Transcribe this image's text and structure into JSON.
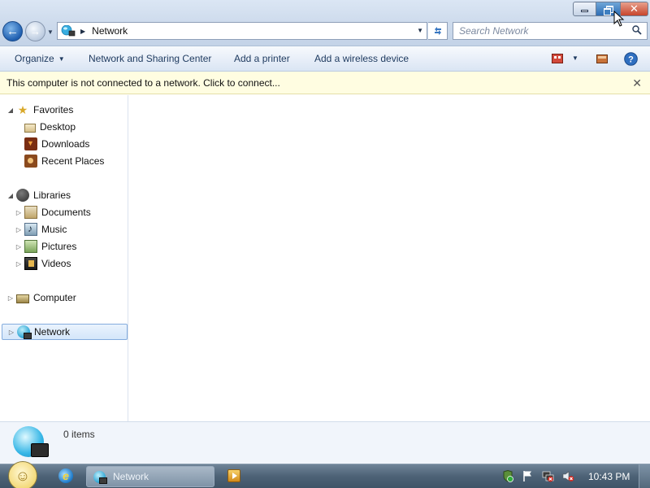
{
  "window": {
    "caption_buttons": {
      "minimize_icon": "minimize-icon",
      "restore_icon": "restore-icon",
      "close_icon": "close-icon"
    }
  },
  "navigation": {
    "back_icon": "back-arrow-icon",
    "forward_icon": "forward-arrow-icon"
  },
  "address_bar": {
    "location_icon": "network-icon",
    "path": "Network"
  },
  "search": {
    "placeholder": "Search Network"
  },
  "command_bar": {
    "organize": "Organize",
    "network_sharing_center": "Network and Sharing Center",
    "add_printer": "Add a printer",
    "add_wireless_device": "Add a wireless device"
  },
  "info_bar": {
    "message": "This computer is not connected to a network. Click to connect..."
  },
  "nav_pane": {
    "favorites": {
      "label": "Favorites",
      "items": [
        "Desktop",
        "Downloads",
        "Recent Places"
      ]
    },
    "libraries": {
      "label": "Libraries",
      "items": [
        "Documents",
        "Music",
        "Pictures",
        "Videos"
      ]
    },
    "computer": "Computer",
    "network": "Network"
  },
  "details_pane": {
    "item_count": "0 items"
  },
  "taskbar": {
    "active_task": "Network",
    "clock": "10:43 PM"
  },
  "colors": {
    "accent": "#2e6db4",
    "info_bar_bg": "#fffde1",
    "close_button": "#c7452c",
    "taskbar": "#4d6276"
  }
}
